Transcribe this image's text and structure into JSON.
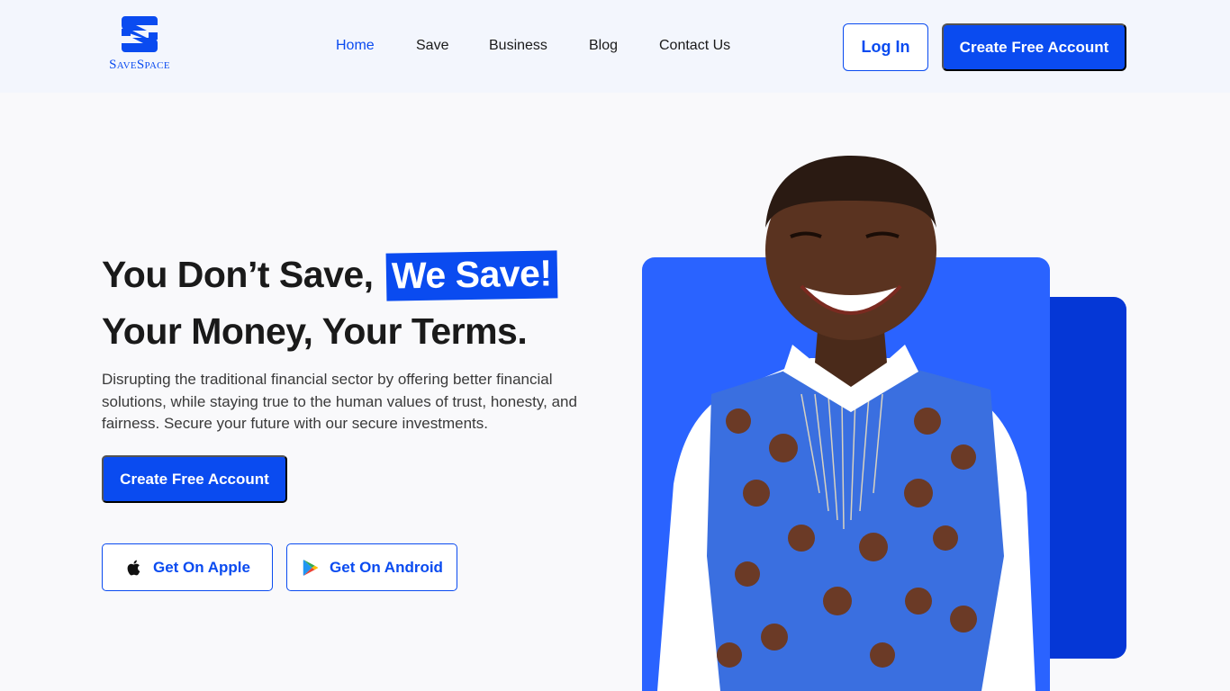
{
  "brand": {
    "name": "SaveSpace",
    "accent": "#0a4bf0"
  },
  "nav": {
    "items": [
      {
        "label": "Home",
        "active": true
      },
      {
        "label": "Save",
        "active": false
      },
      {
        "label": "Business",
        "active": false
      },
      {
        "label": "Blog",
        "active": false
      },
      {
        "label": "Contact Us",
        "active": false
      }
    ]
  },
  "header": {
    "login_label": "Log In",
    "create_label": "Create Free Account"
  },
  "hero": {
    "headline_prefix": "You Don’t Save,",
    "headline_highlight": "We Save!",
    "headline_line2": "Your Money, Your Terms.",
    "description": "Disrupting the traditional financial sector by offering better financial solutions, while staying true to the human values of trust, honesty, and fairness. Secure your future with our secure investments.",
    "cta_label": "Create Free Account",
    "apple_label": "Get On Apple",
    "android_label": "Get On Android"
  },
  "colors": {
    "primary": "#0a4bf0",
    "card_front": "#2a63ff",
    "card_back": "#0537d6",
    "header_bg": "#f3f6fd"
  }
}
